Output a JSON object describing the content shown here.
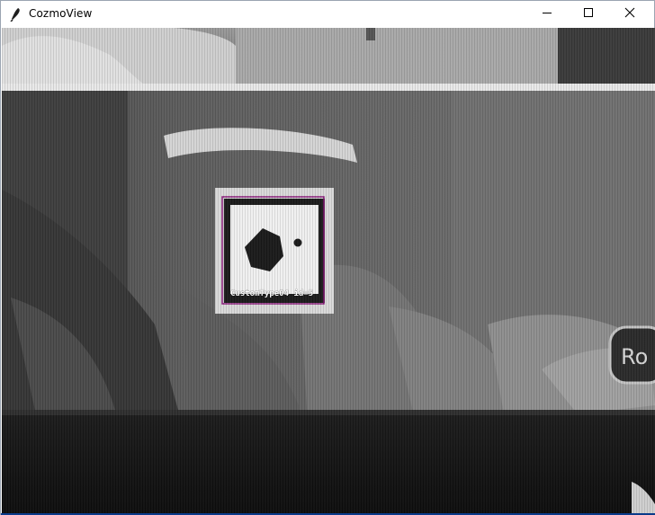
{
  "window": {
    "title": "CozmoView",
    "app_icon": "feather-icon",
    "controls": {
      "minimize_icon": "minimize-icon",
      "maximize_icon": "maximize-icon",
      "close_icon": "close-icon"
    }
  },
  "camera_view": {
    "detection": {
      "label": "CustomType04 id=5",
      "box_color": "#8a1a7a"
    },
    "colors": {
      "accent": "#8a1a7a",
      "frame_dark": "#141414"
    }
  }
}
